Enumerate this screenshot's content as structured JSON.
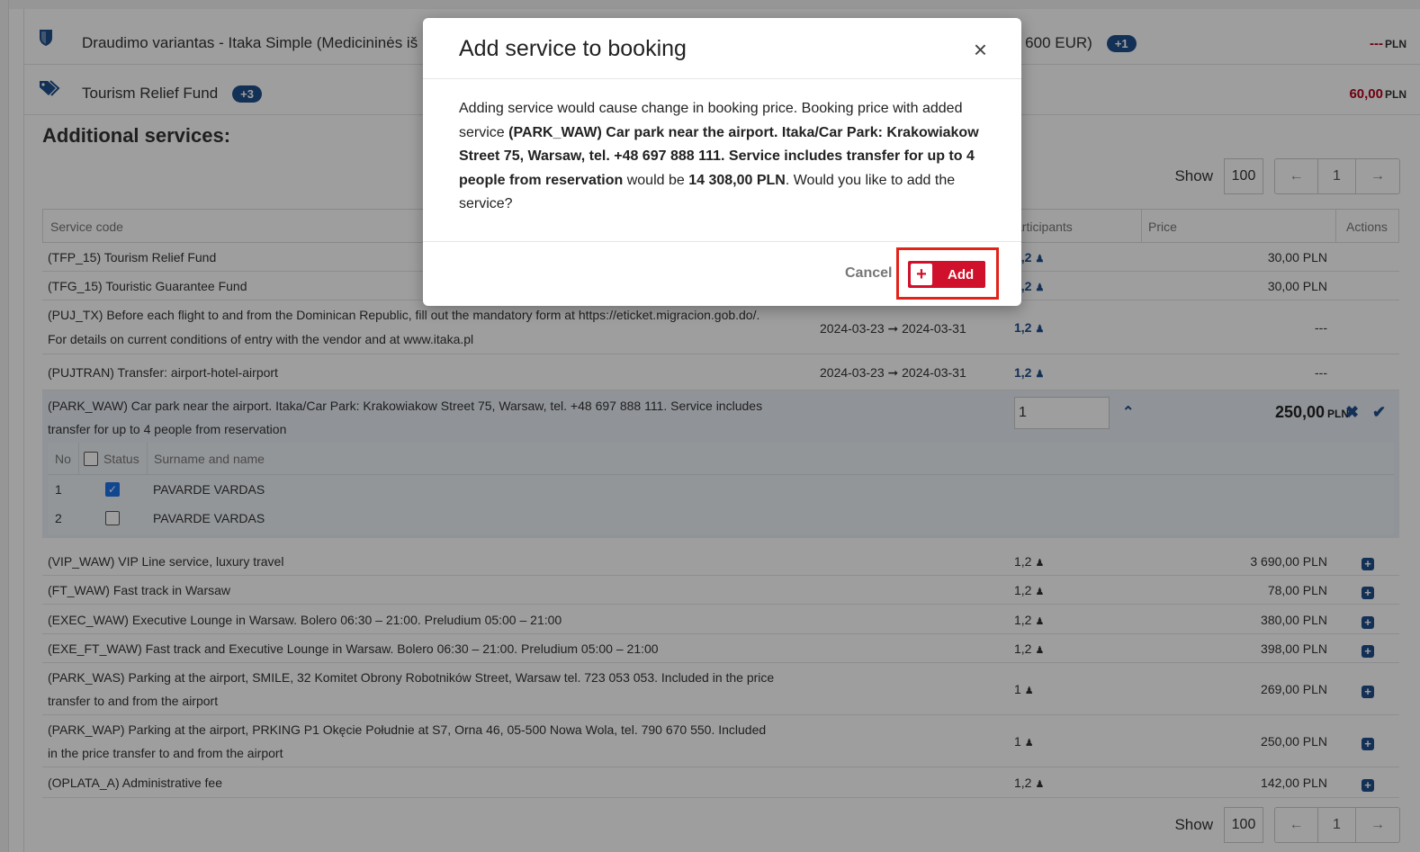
{
  "insurance": {
    "row1_text": "Draudimo variantas - Itaka Simple (Medicininės iš",
    "row1_tail": "u 600 EUR)",
    "row1_badge": "+1",
    "row1_price_value": "---",
    "row1_price_cur": "PLN",
    "row2_text": "Tourism Relief Fund",
    "row2_badge": "+3",
    "row2_price_value": "60,00",
    "row2_price_cur": "PLN"
  },
  "section_title": "Additional services:",
  "pager": {
    "show_label": "Show",
    "per_page": "100",
    "prev": "←",
    "page": "1",
    "next": "→"
  },
  "table": {
    "headers": {
      "code": "Service code",
      "participants": "articipants",
      "price": "Price",
      "actions": "Actions"
    },
    "rows": [
      {
        "desc": "(TFP_15) Tourism Relief Fund",
        "dates": "",
        "participants": "1,2",
        "price": "30,00 PLN"
      },
      {
        "desc": "(TFG_15) Touristic Guarantee Fund",
        "dates": "",
        "participants": "1,2",
        "price": "30,00 PLN"
      },
      {
        "desc_line1": "(PUJ_TX) Before each flight to and from the Dominican Republic, fill out the mandatory form at https://eticket.migracion.gob.do/.",
        "desc_line2": "For details on current conditions of entry with the vendor and at www.itaka.pl",
        "dates": "2024-03-23 ➞ 2024-03-31",
        "participants": "1,2",
        "price": "---"
      },
      {
        "desc": "(PUJTRAN) Transfer: airport-hotel-airport",
        "dates": "2024-03-23 ➞ 2024-03-31",
        "participants": "1,2",
        "price": "---"
      }
    ],
    "selected": {
      "desc_line1": "(PARK_WAW) Car park near the airport. Itaka/Car Park: Krakowiakow Street 75, Warsaw, tel. +48 697 888 111. Service includes",
      "desc_line2": "transfer for up to 4 people from reservation",
      "qty": "1",
      "price_value": "250,00",
      "price_cur": "PLN",
      "sub_headers": {
        "no": "No",
        "status": "Status",
        "name": "Surname and name"
      },
      "people": [
        {
          "no": "1",
          "name": "PAVARDE VARDAS",
          "checked": true
        },
        {
          "no": "2",
          "name": "PAVARDE VARDAS",
          "checked": false
        }
      ]
    },
    "more_rows": [
      {
        "desc": "(VIP_WAW) VIP Line service, luxury travel",
        "participants": "1,2",
        "price": "3 690,00 PLN"
      },
      {
        "desc": "(FT_WAW) Fast track in Warsaw",
        "participants": "1,2",
        "price": "78,00 PLN"
      },
      {
        "desc": "(EXEC_WAW) Executive Lounge in Warsaw. Bolero 06:30 – 21:00. Preludium 05:00 – 21:00",
        "participants": "1,2",
        "price": "380,00 PLN"
      },
      {
        "desc": "(EXE_FT_WAW) Fast track and Executive Lounge in Warsaw. Bolero 06:30 – 21:00. Preludium 05:00 – 21:00",
        "participants": "1,2",
        "price": "398,00 PLN"
      },
      {
        "desc_line1": "(PARK_WAS) Parking at the airport, SMILE, 32 Komitet Obrony Robotników Street, Warsaw tel. 723 053 053. Included in the price",
        "desc_line2": "transfer to and from the airport",
        "participants": "1",
        "price": "269,00 PLN"
      },
      {
        "desc_line1": "(PARK_WAP) Parking at the airport, PRKING P1 Okęcie Południe at S7, Orna 46, 05-500 Nowa Wola, tel. 790 670 550. Included",
        "desc_line2": "in the price transfer to and from the airport",
        "participants": "1",
        "price": "250,00 PLN"
      },
      {
        "desc": "(OPLATA_A) Administrative fee",
        "participants": "1,2",
        "price": "142,00 PLN"
      }
    ]
  },
  "modal": {
    "title": "Add service to booking",
    "close": "×",
    "body_1": "Adding service would cause change in booking price. Booking price with added service ",
    "body_bold": "(PARK_WAW) Car park near the airport. Itaka/Car Park: Krakowiakow Street 75, Warsaw, tel. +48 697 888 111. Service includes transfer for up to 4 people from reservation",
    "body_2": " would be ",
    "body_price": "14 308,00 PLN",
    "body_3": ". Would you like to add the service?",
    "cancel_label": "Cancel",
    "add_label": "Add",
    "add_plus": "+"
  },
  "colors": {
    "brand_blue": "#1f4e8c",
    "add_red": "#d0112b",
    "highlight_red": "#e2231a"
  },
  "icons": {
    "insurance": "shield-icon",
    "fund": "tags-icon",
    "person": "person-icon",
    "add_row": "plus-square-icon",
    "remove": "x-icon",
    "confirm": "check-icon",
    "expand": "chevron-up-icon"
  }
}
